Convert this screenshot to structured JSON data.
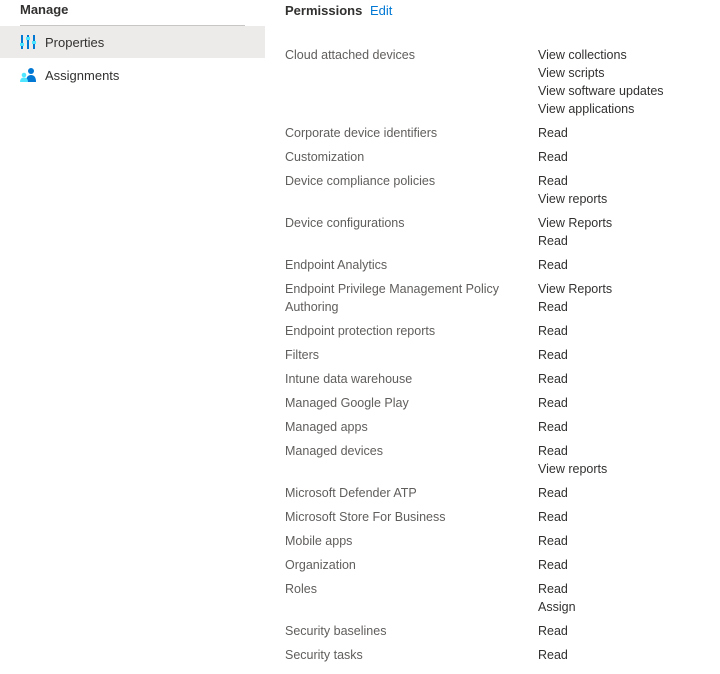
{
  "sidebar": {
    "section_title": "Manage",
    "items": [
      {
        "label": "Properties",
        "icon": "properties-icon",
        "selected": true
      },
      {
        "label": "Assignments",
        "icon": "assignments-icon",
        "selected": false
      }
    ]
  },
  "permissions": {
    "title": "Permissions",
    "edit_label": "Edit",
    "rows": [
      {
        "name": "Cloud attached devices",
        "values": [
          "View collections",
          "View scripts",
          "View software updates",
          "View applications"
        ]
      },
      {
        "name": "Corporate device identifiers",
        "values": [
          "Read"
        ]
      },
      {
        "name": "Customization",
        "values": [
          "Read"
        ]
      },
      {
        "name": "Device compliance policies",
        "values": [
          "Read",
          "View reports"
        ]
      },
      {
        "name": "Device configurations",
        "values": [
          "View Reports",
          "Read"
        ]
      },
      {
        "name": "Endpoint Analytics",
        "values": [
          "Read"
        ]
      },
      {
        "name": "Endpoint Privilege Management Policy Authoring",
        "values": [
          "View Reports",
          "Read"
        ]
      },
      {
        "name": "Endpoint protection reports",
        "values": [
          "Read"
        ]
      },
      {
        "name": "Filters",
        "values": [
          "Read"
        ]
      },
      {
        "name": "Intune data warehouse",
        "values": [
          "Read"
        ]
      },
      {
        "name": "Managed Google Play",
        "values": [
          "Read"
        ]
      },
      {
        "name": "Managed apps",
        "values": [
          "Read"
        ]
      },
      {
        "name": "Managed devices",
        "values": [
          "Read",
          "View reports"
        ]
      },
      {
        "name": "Microsoft Defender ATP",
        "values": [
          "Read"
        ]
      },
      {
        "name": "Microsoft Store For Business",
        "values": [
          "Read"
        ]
      },
      {
        "name": "Mobile apps",
        "values": [
          "Read"
        ]
      },
      {
        "name": "Organization",
        "values": [
          "Read"
        ]
      },
      {
        "name": "Roles",
        "values": [
          "Read",
          "Assign"
        ]
      },
      {
        "name": "Security baselines",
        "values": [
          "Read"
        ]
      },
      {
        "name": "Security tasks",
        "values": [
          "Read"
        ]
      }
    ]
  },
  "colors": {
    "accent": "#0078d4",
    "selected_bg": "#edebe9",
    "text": "#323130",
    "secondary_text": "#605e5c"
  }
}
